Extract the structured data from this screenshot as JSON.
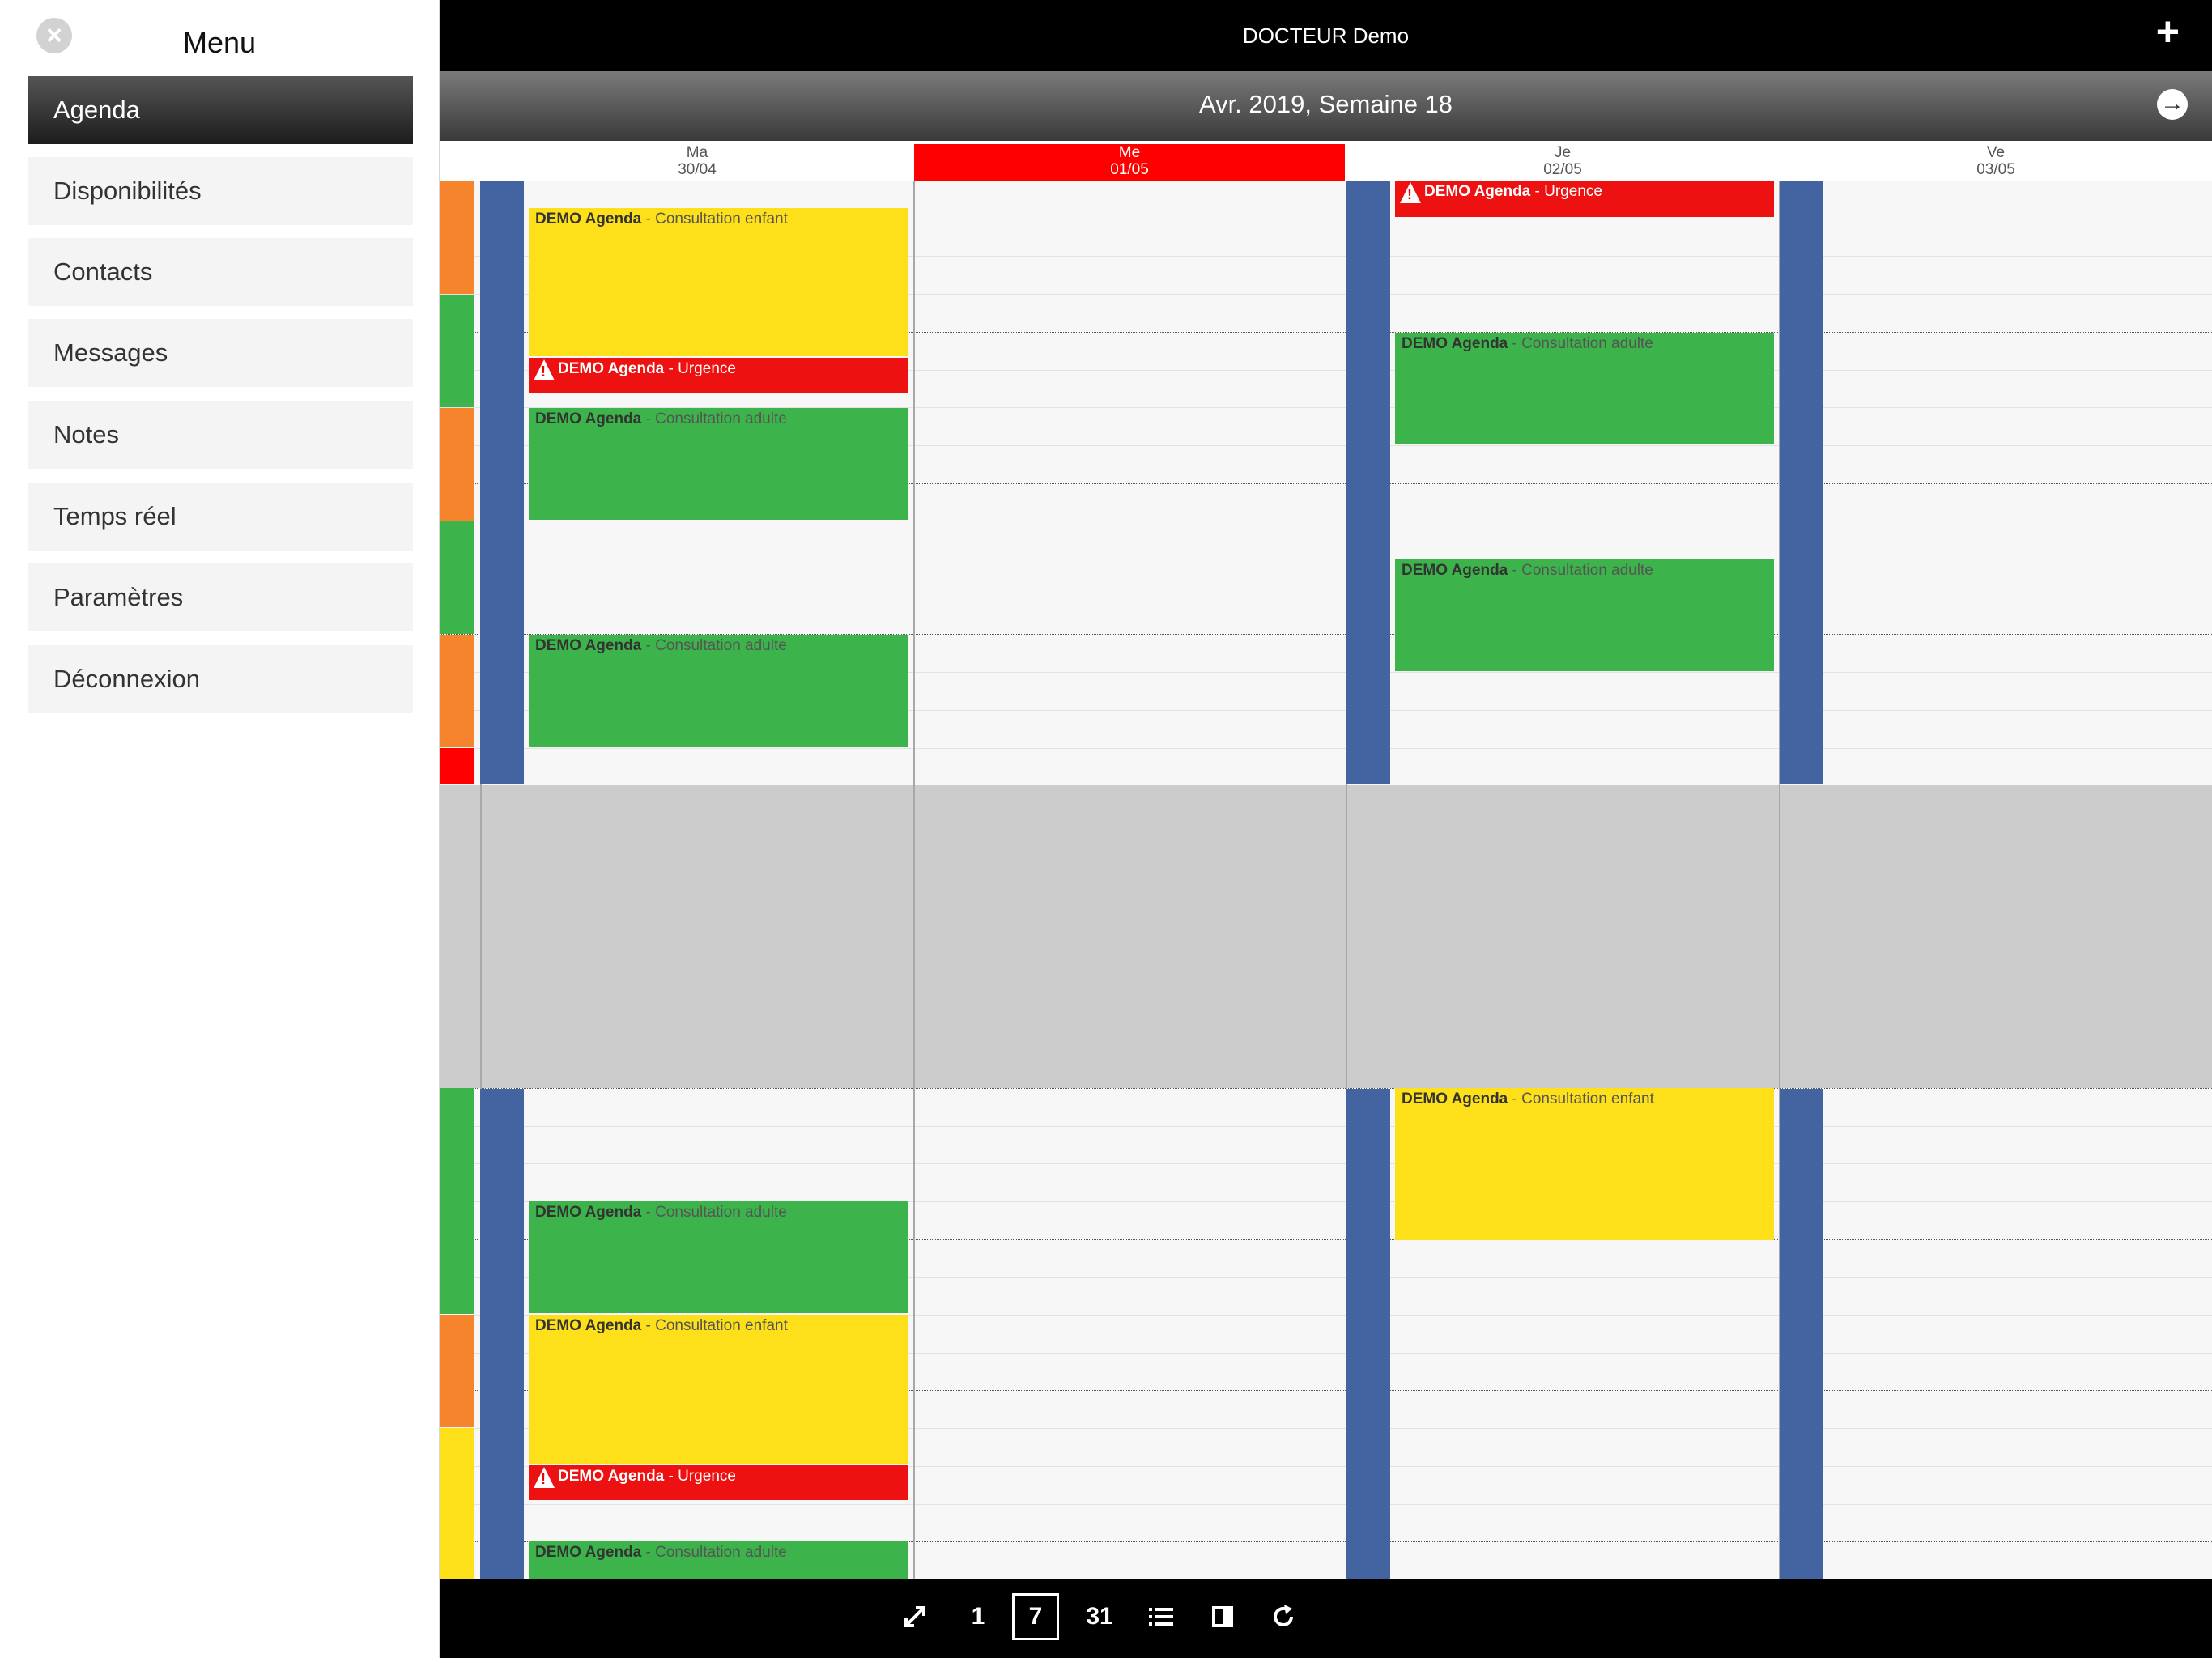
{
  "app": {
    "title": "DOCTEUR Demo"
  },
  "sidebar": {
    "title": "Menu",
    "items": [
      {
        "label": "Agenda",
        "active": true
      },
      {
        "label": "Disponibilités"
      },
      {
        "label": "Contacts"
      },
      {
        "label": "Messages"
      },
      {
        "label": "Notes"
      },
      {
        "label": "Temps réel"
      },
      {
        "label": "Paramètres"
      },
      {
        "label": "Déconnexion"
      }
    ]
  },
  "week": {
    "title": "Avr. 2019, Semaine 18"
  },
  "days": [
    {
      "name": "Ma",
      "date": "30/04",
      "today": false
    },
    {
      "name": "Me",
      "date": "01/05",
      "today": true
    },
    {
      "name": "Je",
      "date": "02/05",
      "today": false
    },
    {
      "name": "Ve",
      "date": "03/05",
      "today": false
    }
  ],
  "events": {
    "ma_1": {
      "title": "DEMO Agenda",
      "type": "- Consultation enfant",
      "color": "#fde01a"
    },
    "ma_2": {
      "title": "DEMO Agenda",
      "type": "- Urgence",
      "color": "#ee1111"
    },
    "ma_3": {
      "title": "DEMO Agenda",
      "type": "- Consultation adulte",
      "color": "#3cb44b"
    },
    "ma_4": {
      "title": "DEMO Agenda",
      "type": "- Consultation adulte",
      "color": "#3cb44b"
    },
    "ma_5": {
      "title": "DEMO Agenda",
      "type": "- Consultation adulte",
      "color": "#3cb44b"
    },
    "ma_6": {
      "title": "DEMO Agenda",
      "type": "- Consultation enfant",
      "color": "#fde01a"
    },
    "ma_7": {
      "title": "DEMO Agenda",
      "type": "- Urgence",
      "color": "#ee1111"
    },
    "ma_8": {
      "title": "DEMO Agenda",
      "type": "- Consultation adulte",
      "color": "#3cb44b"
    },
    "je_1": {
      "title": "DEMO Agenda",
      "type": "- Urgence",
      "color": "#ee1111"
    },
    "je_2": {
      "title": "DEMO Agenda",
      "type": "- Consultation adulte",
      "color": "#3cb44b"
    },
    "je_3": {
      "title": "DEMO Agenda",
      "type": "- Consultation adulte",
      "color": "#3cb44b"
    },
    "je_4": {
      "title": "DEMO Agenda",
      "type": "- Consultation enfant",
      "color": "#fde01a"
    }
  },
  "toolbar": {
    "expand_icon": "expand-icon",
    "day_label": "1",
    "week_label": "7",
    "month_label": "31",
    "list_icon": "list-icon",
    "split_icon": "split-view-icon",
    "refresh_icon": "refresh-icon",
    "selected_view": "7"
  },
  "colors": {
    "today": "#ff0000",
    "blue_bar": "#4463a1",
    "green": "#3cb44b",
    "yellow": "#fde01a",
    "orange": "#f5842d",
    "red": "#ee1111",
    "gray_band": "#cccccc"
  }
}
